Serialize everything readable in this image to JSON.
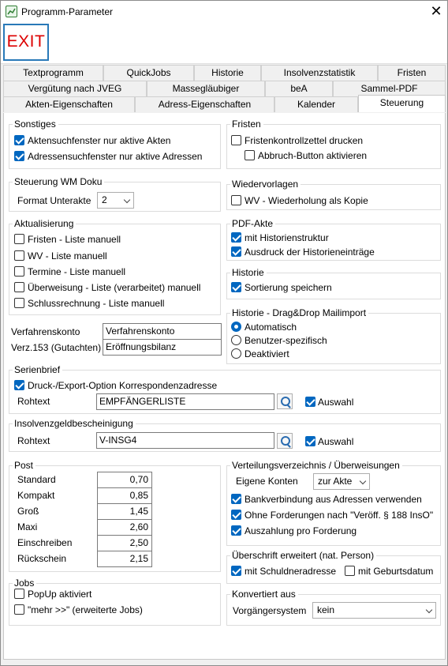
{
  "window": {
    "title": "Programm-Parameter",
    "close": "✕"
  },
  "toolbar": {
    "exit": "EXIT"
  },
  "tabs": {
    "row1": [
      "Textprogramm",
      "QuickJobs",
      "Historie",
      "Insolvenzstatistik",
      "Fristen"
    ],
    "row2": [
      "Vergütung nach JVEG",
      "Massegläubiger",
      "beA",
      "Sammel-PDF"
    ],
    "row3": [
      "Akten-Eigenschaften",
      "Adress-Eigenschaften",
      "Kalender",
      "Steuerung"
    ],
    "active": "Steuerung"
  },
  "sonstiges": {
    "title": "Sonstiges",
    "items": [
      {
        "label": "Aktensuchfenster nur aktive Akten",
        "checked": true
      },
      {
        "label": "Adressensuchfenster nur aktive Adressen",
        "checked": true
      }
    ]
  },
  "fristen": {
    "title": "Fristen",
    "items": [
      {
        "label": "Fristenkontrollzettel drucken",
        "checked": false
      },
      {
        "label": "Abbruch-Button aktivieren",
        "checked": false
      }
    ]
  },
  "wmdoku": {
    "title": "Steuerung WM Doku",
    "label": "Format Unterakte",
    "value": "2"
  },
  "wiedervorlagen": {
    "title": "Wiedervorlagen",
    "items": [
      {
        "label": "WV - Wiederholung als Kopie",
        "checked": false
      }
    ]
  },
  "aktualisierung": {
    "title": "Aktualisierung",
    "items": [
      {
        "label": "Fristen - Liste manuell",
        "checked": false
      },
      {
        "label": "WV - Liste manuell",
        "checked": false
      },
      {
        "label": "Termine - Liste manuell",
        "checked": false
      },
      {
        "label": "Überweisung - Liste (verarbeitet) manuell",
        "checked": false
      },
      {
        "label": "Schlussrechnung - Liste manuell",
        "checked": false
      }
    ]
  },
  "pdfakte": {
    "title": "PDF-Akte",
    "items": [
      {
        "label": "mit Historienstruktur",
        "checked": true
      },
      {
        "label": "Ausdruck der Historieneinträge",
        "checked": true
      }
    ]
  },
  "historie": {
    "title": "Historie",
    "items": [
      {
        "label": "Sortierung speichern",
        "checked": true
      }
    ]
  },
  "dragdrop": {
    "title": "Historie - Drag&Drop Mailimport",
    "options": [
      "Automatisch",
      "Benutzer-spezifisch",
      "Deaktiviert"
    ],
    "selected": "Automatisch"
  },
  "konten": {
    "verfahren_label": "Verfahrenskonto",
    "verfahren_value": "Verfahrenskonto",
    "verz_label": "Verz.153 (Gutachten)",
    "verz_value": "Eröffnungsbilanz"
  },
  "serienbrief": {
    "title": "Serienbrief",
    "check_label": "Druck-/Export-Option Korrespondenzadresse",
    "checked": true,
    "rohtext_label": "Rohtext",
    "rohtext_value": "EMPFÄNGERLISTE",
    "auswahl": "Auswahl",
    "auswahl_checked": true
  },
  "insolvenzgeld": {
    "title": "Insolvenzgeldbescheinigung",
    "rohtext_label": "Rohtext",
    "rohtext_value": "V-INSG4",
    "auswahl": "Auswahl",
    "auswahl_checked": true
  },
  "post": {
    "title": "Post",
    "rows": [
      {
        "label": "Standard",
        "value": "0,70"
      },
      {
        "label": "Kompakt",
        "value": "0,85"
      },
      {
        "label": "Groß",
        "value": "1,45"
      },
      {
        "label": "Maxi",
        "value": "2,60"
      },
      {
        "label": "Einschreiben",
        "value": "2,50"
      },
      {
        "label": "Rückschein",
        "value": "2,15"
      }
    ]
  },
  "verteilung": {
    "title": "Verteilungsverzeichnis / Überweisungen",
    "konten_label": "Eigene Konten",
    "konten_value": "zur Akte",
    "items": [
      {
        "label": "Bankverbindung aus Adressen verwenden",
        "checked": true
      },
      {
        "label": "Ohne Forderungen nach \"Veröff. § 188 InsO\"",
        "checked": true
      },
      {
        "label": "Auszahlung pro Forderung",
        "checked": true
      }
    ]
  },
  "jobs": {
    "title": "Jobs",
    "items": [
      {
        "label": "PopUp aktiviert",
        "checked": false
      },
      {
        "label": "\"mehr >>\" (erweiterte Jobs)",
        "checked": false
      }
    ]
  },
  "ueberschrift": {
    "title": "Überschrift erweitert (nat. Person)",
    "items": [
      {
        "label": "mit Schuldneradresse",
        "checked": true
      },
      {
        "label": "mit Geburtsdatum",
        "checked": false
      }
    ]
  },
  "konvertiert": {
    "title": "Konvertiert aus",
    "label": "Vorgängersystem",
    "value": "kein"
  }
}
